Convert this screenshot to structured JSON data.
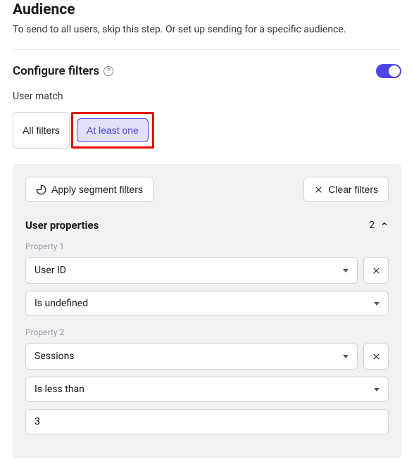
{
  "header": {
    "title": "Audience",
    "desc": "To send to all users, skip this step. Or set up sending for a specific audience."
  },
  "config": {
    "label": "Configure filters",
    "toggleOn": true
  },
  "userMatch": {
    "label": "User match",
    "options": {
      "all": "All filters",
      "atLeastOne": "At least one"
    }
  },
  "actions": {
    "applySegment": "Apply segment filters",
    "clear": "Clear filters"
  },
  "userProperties": {
    "title": "User properties",
    "count": "2",
    "items": [
      {
        "label": "Property 1",
        "field": "User ID",
        "operator": "Is undefined",
        "value": null
      },
      {
        "label": "Property 2",
        "field": "Sessions",
        "operator": "Is less than",
        "value": "3"
      }
    ]
  }
}
